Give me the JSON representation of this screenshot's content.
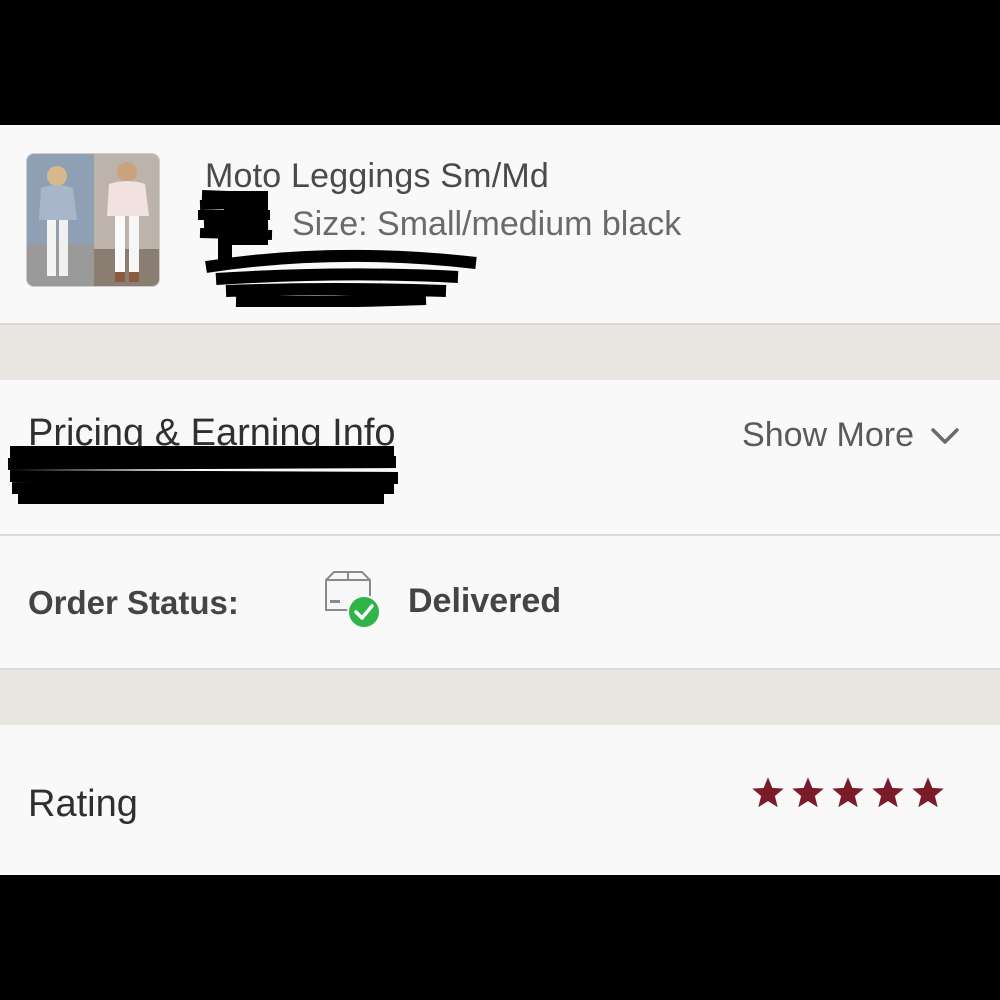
{
  "product": {
    "title": "Moto Leggings Sm/Md",
    "size": "Size: Small/medium black",
    "thumbnail_icon": "product-photo"
  },
  "pricing": {
    "title": "Pricing & Earning Info",
    "show_more": "Show More",
    "show_more_icon": "chevron-down-icon"
  },
  "order_status": {
    "label": "Order Status:",
    "value": "Delivered",
    "icon": "package-delivered-icon",
    "check_color": "#2fb44a"
  },
  "rating": {
    "label": "Rating",
    "stars": 5,
    "max_stars": 5,
    "star_color": "#7a1d2b"
  }
}
